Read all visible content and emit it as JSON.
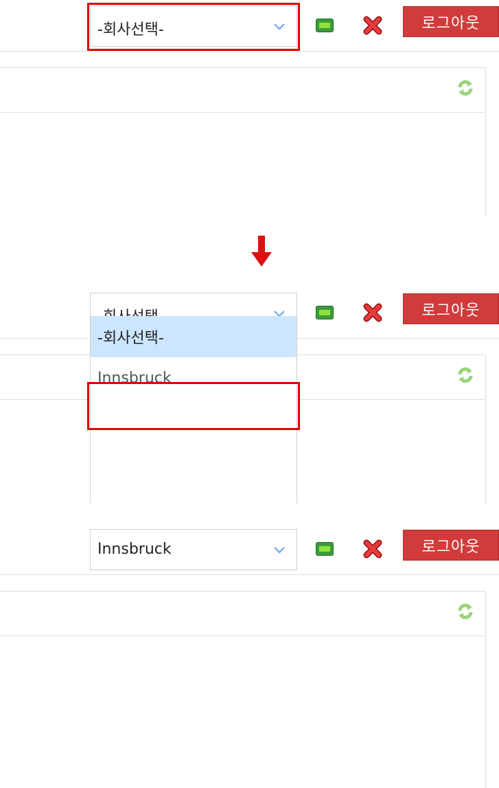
{
  "step1": {
    "company_select": {
      "value": "-회사선택-"
    },
    "logout_label": "로그아웃"
  },
  "step2": {
    "company_select": {
      "value": "-회사선택-",
      "options": [
        "-회사선택-",
        "Innsbruck"
      ],
      "highlighted_option": "-회사선택-"
    },
    "logout_label": "로그아웃"
  },
  "step3": {
    "company_select": {
      "value": "Innsbruck"
    },
    "logout_label": "로그아웃"
  },
  "colors": {
    "logout_bg": "#d23b3b",
    "highlight_box": "#e00000",
    "option_highlight": "#cce6ff",
    "arrow": "#dd1111",
    "minimize_icon": "#3b9b3b",
    "refresh_icon": "#9bd37a"
  },
  "icons": [
    "chevron-down-icon",
    "minimize-icon",
    "close-icon",
    "refresh-icon",
    "down-arrow-icon"
  ]
}
